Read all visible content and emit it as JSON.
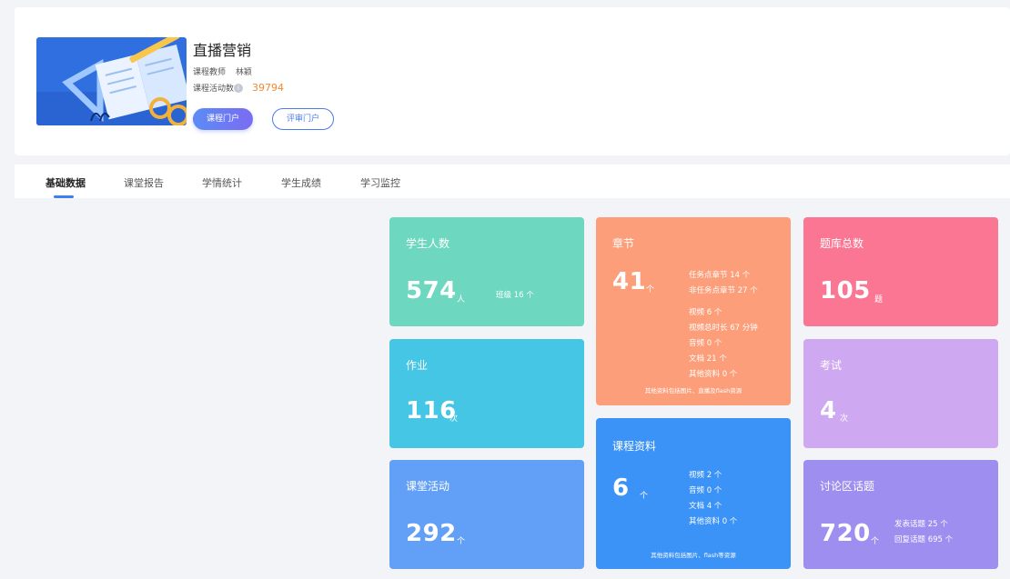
{
  "course": {
    "title": "直播营销",
    "teacher_label": "课程教师",
    "teacher_name": "林颖",
    "activity_label": "课程活动数",
    "activity_count": "39794",
    "portal_button": "课程门户",
    "review_button": "评审门户"
  },
  "tabs": [
    {
      "label": "基础数据",
      "active": true
    },
    {
      "label": "课堂报告",
      "active": false
    },
    {
      "label": "学情统计",
      "active": false
    },
    {
      "label": "学生成绩",
      "active": false
    },
    {
      "label": "学习监控",
      "active": false
    }
  ],
  "stats": {
    "students": {
      "title": "学生人数",
      "value": "574",
      "unit": "人",
      "detail": "班级 16 个",
      "color": "#6dd8bf"
    },
    "homework": {
      "title": "作业",
      "value": "116",
      "unit": "次",
      "color": "#44c6e4"
    },
    "activities": {
      "title": "课堂活动",
      "value": "292",
      "unit": "个",
      "color": "#62a0f7"
    },
    "chapters": {
      "title": "章节",
      "value": "41",
      "unit": "个",
      "details": [
        "任务点章节 14 个",
        "非任务点章节 27 个"
      ],
      "sub_details": [
        "视频 6 个",
        "视频总时长 67 分钟",
        "音频 0 个",
        "文档 21 个",
        "其他资料 0 个"
      ],
      "note": "其他资料包括图片、直播及flash资源",
      "color": "#fd9e7a"
    },
    "materials": {
      "title": "课程资料",
      "value": "6",
      "unit": "个",
      "details": [
        "视频 2 个",
        "音频 0 个",
        "文档 4 个",
        "其他资料 0 个"
      ],
      "note": "其他资料包括图片、flash等资源",
      "color": "#3b92f7"
    },
    "question_bank": {
      "title": "题库总数",
      "value": "105",
      "unit": "题",
      "color": "#fb7693"
    },
    "exams": {
      "title": "考试",
      "value": "4",
      "unit": "次",
      "color": "#cea8f0"
    },
    "discussion": {
      "title": "讨论区话题",
      "value": "720",
      "unit": "个",
      "details": [
        "发表话题 25 个",
        "回复话题 695 个"
      ],
      "color": "#9d8ef0"
    }
  },
  "icons": {
    "info": "info-icon",
    "cover": "course-cover-illustration"
  }
}
